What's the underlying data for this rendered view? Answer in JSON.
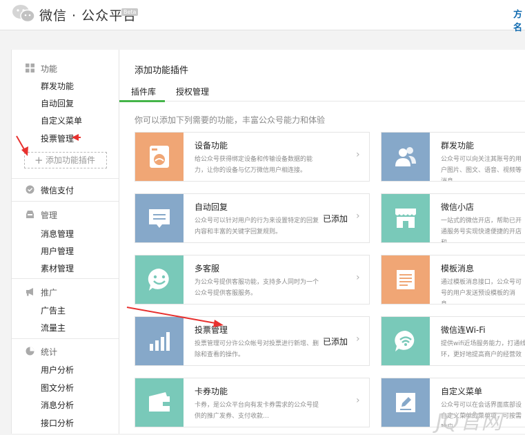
{
  "header": {
    "logo_icon": "wechat-logo-icon",
    "title": "微信 · 公众平台",
    "beta": "Beta",
    "brand_text": "方名"
  },
  "sidebar": {
    "sections": [
      {
        "label": "功能",
        "icon": "grid-icon",
        "items": [
          "群发功能",
          "自动回复",
          "自定义菜单",
          "投票管理"
        ]
      },
      {
        "label": "微信支付",
        "icon": "payment-icon",
        "items": []
      },
      {
        "label": "管理",
        "icon": "inbox-icon",
        "items": [
          "消息管理",
          "用户管理",
          "素材管理"
        ]
      },
      {
        "label": "推广",
        "icon": "megaphone-icon",
        "items": [
          "广告主",
          "流量主"
        ]
      },
      {
        "label": "统计",
        "icon": "pie-chart-icon",
        "items": [
          "用户分析",
          "图文分析",
          "消息分析",
          "接口分析"
        ]
      }
    ],
    "add_plugin_label": "添加功能插件"
  },
  "main": {
    "title": "添加功能插件",
    "tabs": [
      {
        "label": "插件库",
        "active": true
      },
      {
        "label": "授权管理",
        "active": false
      }
    ],
    "hint": "你可以添加下列需要的功能，丰富公众号能力和体验",
    "plugins_left": [
      {
        "name": "设备功能",
        "desc": "给公众号获得绑定设备和传输设备数据的能力，让你的设备与亿万微信用户相连接。",
        "status": "",
        "color": "#f0a675",
        "icon": "washing-machine-icon"
      },
      {
        "name": "自动回复",
        "desc": "公众号可以针对用户的行为来设置特定的回复内容和丰富的关键字回复规则。",
        "status": "已添加",
        "color": "#86a8c9",
        "icon": "chat-bubble-icon"
      },
      {
        "name": "多客服",
        "desc": "为公众号提供客服功能，支持多人同时为一个公众号提供客服服务。",
        "status": "",
        "color": "#79c9b9",
        "icon": "smiley-icon"
      },
      {
        "name": "投票管理",
        "desc": "投票管理可分许公众帐号对投票进行新增、删除和查看的操作。",
        "status": "已添加",
        "color": "#86a8c9",
        "icon": "bar-chart-icon"
      },
      {
        "name": "卡券功能",
        "desc": "卡券，是公众平台向有发卡券需求的公众号提供的推广发券、支付收款…",
        "status": "",
        "color": "#79c9b9",
        "icon": "wallet-icon"
      }
    ],
    "plugins_right": [
      {
        "name": "群发功能",
        "desc": "公众号可以向关注其账号的用户图片、图文、语音、视频等消息",
        "color": "#86a8c9",
        "icon": "users-icon"
      },
      {
        "name": "微信小店",
        "desc": "一站式的微信开店，帮助已开通服务号实现快速便捷的开店和",
        "color": "#79c9b9",
        "icon": "shop-icon"
      },
      {
        "name": "模板消息",
        "desc": "通过模板消息接口，公众号可号的用户发送预设模板的消息。",
        "color": "#f0a675",
        "icon": "document-icon"
      },
      {
        "name": "微信连Wi-Fi",
        "desc": "提供wifi近场服务能力，打通线环，更好地提高商户的经营效",
        "color": "#79c9b9",
        "icon": "wifi-icon"
      },
      {
        "name": "自定义菜单",
        "desc": "公众号可以在会话界面底部设自定义菜单的菜单项，可按需响应",
        "color": "#86a8c9",
        "icon": "pencil-icon"
      }
    ]
  },
  "watermark": "JQ官网"
}
